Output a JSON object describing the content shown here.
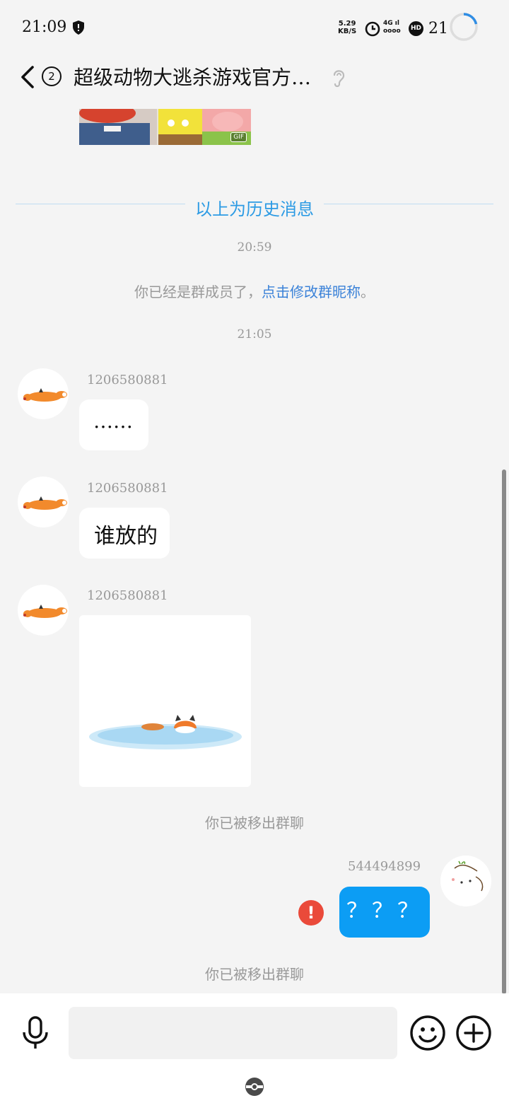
{
  "status_bar": {
    "time": "21:09",
    "speed_value": "5.29",
    "speed_unit": "KB/S",
    "network": "4G",
    "hd_badge": "HD",
    "battery": "21"
  },
  "header": {
    "unread_count": "2",
    "title": "超级动物大逃杀游戏官方…"
  },
  "history_divider": "以上为历史消息",
  "messages": {
    "gif_badge": "GIF",
    "ts1": "20:59",
    "sys_member_prefix": "你已经是群成员了，",
    "sys_member_link": "点击修改群昵称",
    "sys_member_suffix": "。",
    "ts2": "21:05",
    "m1_sender": "1206580881",
    "m1_text": "……",
    "m2_sender": "1206580881",
    "m2_text": "谁放的",
    "m3_sender": "1206580881",
    "removed_1": "你已被移出群聊",
    "me_sender": "544494899",
    "me_text": "？？？",
    "error_mark": "!",
    "removed_2": "你已被移出群聊"
  },
  "input": {
    "placeholder": ""
  },
  "colors": {
    "accent": "#0c9df4",
    "error": "#ea4a3a",
    "link": "#3b82d8",
    "divider": "#2d9be4"
  }
}
